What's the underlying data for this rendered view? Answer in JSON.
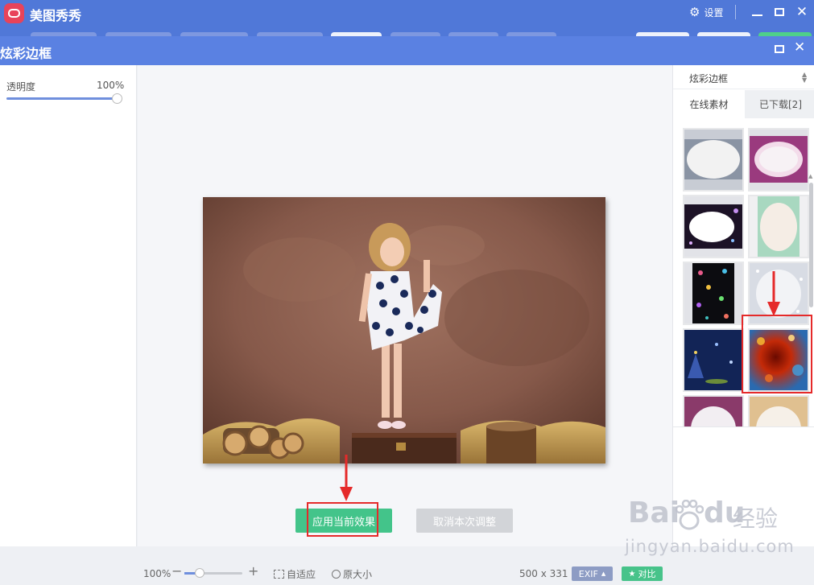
{
  "app": {
    "title": "美图秀秀",
    "settings_label": "设置"
  },
  "colors": {
    "titlebar": "#5078d8",
    "panel_header": "#5a81e2",
    "apply_button": "#43c48a",
    "highlight": "#e52a2a",
    "exif_button": "#8d9cc4",
    "compare_button": "#47c38a"
  },
  "panel": {
    "title": "炫彩边框"
  },
  "left_panel": {
    "opacity_label": "透明度",
    "opacity_value": "100%",
    "opacity_level": 1.0
  },
  "canvas": {
    "photo_description_icon": "girl-polka-dot-dress-photo",
    "apply_label": "应用当前效果",
    "cancel_label": "取消本次调整"
  },
  "right_panel": {
    "category": "炫彩边框",
    "tabs": [
      {
        "label": "在线素材",
        "active": true
      },
      {
        "label": "已下载[2]",
        "active": false
      }
    ],
    "thumbnails": [
      {
        "name": "frame-soft-white"
      },
      {
        "name": "frame-pink-purple"
      },
      {
        "name": "frame-sparkle-purple"
      },
      {
        "name": "frame-mint-glow"
      },
      {
        "name": "frame-hearts-bokeh"
      },
      {
        "name": "frame-snow-silver"
      },
      {
        "name": "frame-christmas-tree"
      },
      {
        "name": "frame-orange-bokeh",
        "selected": true
      },
      {
        "name": "frame-light-1"
      },
      {
        "name": "frame-light-2"
      }
    ]
  },
  "statusbar": {
    "zoom": "100%",
    "zoom_minus": "−",
    "zoom_plus": "+",
    "zoom_level": 0.2,
    "fit_label": "自适应",
    "original_label": "原大小",
    "dimensions": "500 x 331",
    "exif_label": "EXIF",
    "compare_label": "对比"
  },
  "watermark": {
    "brand_a": "Bai",
    "brand_b": "du",
    "brand_cn": "经验",
    "url": "jingyan.baidu.com"
  }
}
